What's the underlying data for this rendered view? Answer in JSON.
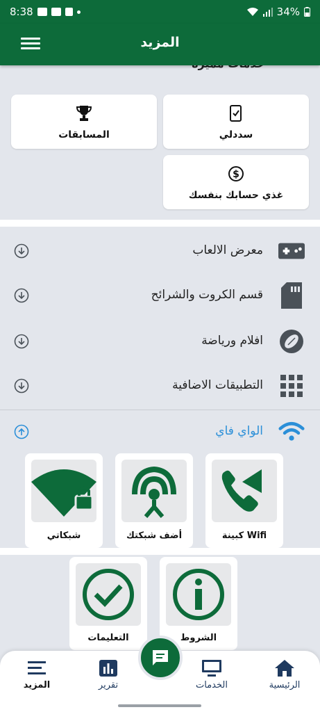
{
  "status": {
    "time": "8:38",
    "battery": "34%"
  },
  "app_bar": {
    "title": "المزيد"
  },
  "section_cut_heading": "خدمات مميزة",
  "feature_cards": [
    {
      "label": "سددلي",
      "icon": "phone-check-icon"
    },
    {
      "label": "المسابقات",
      "icon": "trophy-icon"
    },
    {
      "label": "غذي حسابك بنفسك",
      "icon": "dollar-circle-icon"
    }
  ],
  "list": [
    {
      "label": "معرض الالعاب",
      "icon": "gamepad-icon"
    },
    {
      "label": "قسم الكروت والشرائح",
      "icon": "sim-card-icon"
    },
    {
      "label": "افلام ورياضة",
      "icon": "football-icon"
    },
    {
      "label": "التطبيقات الاضافية",
      "icon": "apps-grid-icon"
    }
  ],
  "wifi": {
    "label": "الواي فاي",
    "cards": [
      {
        "label": "كبينة Wifi",
        "icon": "wifi-phone-icon"
      },
      {
        "label": "أضف شبكتك",
        "icon": "antenna-icon"
      },
      {
        "label": "شبكاتي",
        "icon": "wifi-lock-icon"
      }
    ]
  },
  "info_cards": [
    {
      "label": "الشروط",
      "icon": "info-icon"
    },
    {
      "label": "التعليمات",
      "icon": "check-circle-icon"
    }
  ],
  "bottom_nav": [
    {
      "label": "الرئيسية",
      "icon": "home-icon"
    },
    {
      "label": "الخدمات",
      "icon": "monitor-icon"
    },
    {
      "label": "تقرير",
      "icon": "bar-chart-icon"
    },
    {
      "label": "المزيد",
      "icon": "list-icon"
    }
  ],
  "colors": {
    "primary": "#0d6b3a",
    "wifi_blue": "#2b8fd8",
    "background": "#e3e6ec"
  }
}
